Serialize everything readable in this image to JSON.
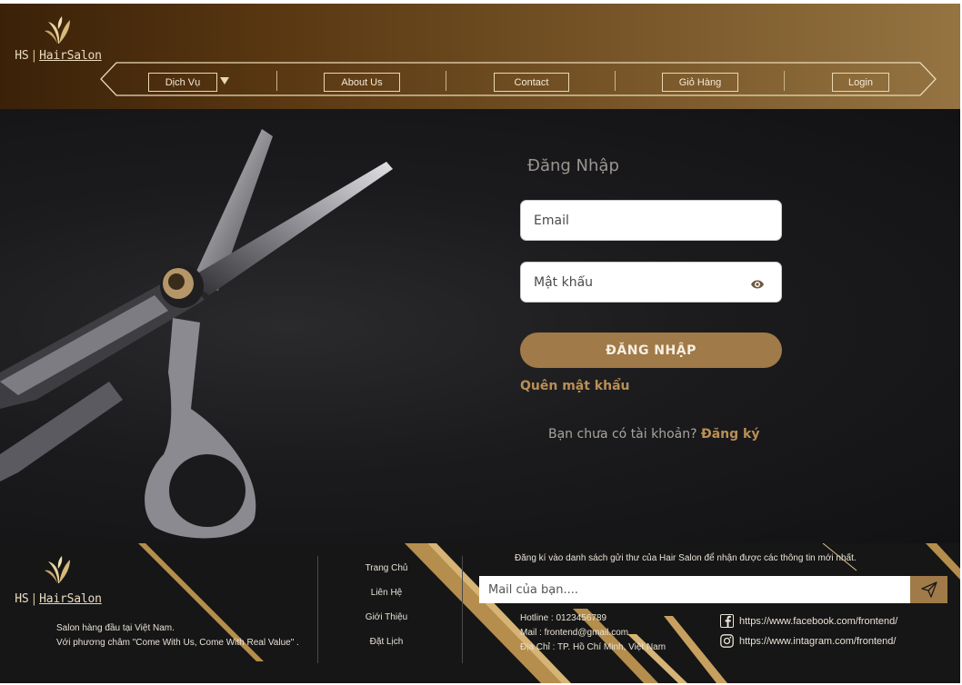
{
  "brand": {
    "short": "HS",
    "separator": "|",
    "name": "HairSalon"
  },
  "nav": {
    "items": [
      {
        "label": "Dịch Vụ"
      },
      {
        "label": "About Us"
      },
      {
        "label": "Contact"
      },
      {
        "label": "Giỏ Hàng"
      },
      {
        "label": "Login"
      }
    ]
  },
  "login": {
    "title": "Đăng Nhập",
    "email_placeholder": "Email",
    "password_placeholder": "Mật khẩu",
    "submit_label": "ĐĂNG NHẬP",
    "forgot_label": "Quên mật khẩu",
    "signup_prompt": "Bạn chưa có tài khoản?",
    "signup_link": "Đăng ký"
  },
  "footer": {
    "tagline_1": "Salon hàng đầu tại Việt Nam.",
    "tagline_2": "Với phương châm \"Come With Us, Come With Real Value\" .",
    "links": [
      {
        "label": "Trang Chủ"
      },
      {
        "label": "Liên Hệ"
      },
      {
        "label": "Giới Thiệu"
      },
      {
        "label": "Đặt Lịch"
      }
    ],
    "newsletter_text": "Đăng kí vào danh sách gửi thư của Hair Salon để nhận được các thông tin mới nhất.",
    "mail_placeholder": "Mail của bạn....",
    "hotline": "Hotline : 0123456789",
    "mail": "Mail : frontend@gmail.com",
    "address": "Địa Chỉ : TP. Hồ Chí Minh, Việt Nam",
    "facebook_url": "https://www.facebook.com/frontend/",
    "instagram_url": "https://www.intagram.com/frontend/"
  },
  "colors": {
    "accent": "#a07a48",
    "link_gold": "#b98f55",
    "header_dark": "#3a2108",
    "header_light": "#957442"
  }
}
